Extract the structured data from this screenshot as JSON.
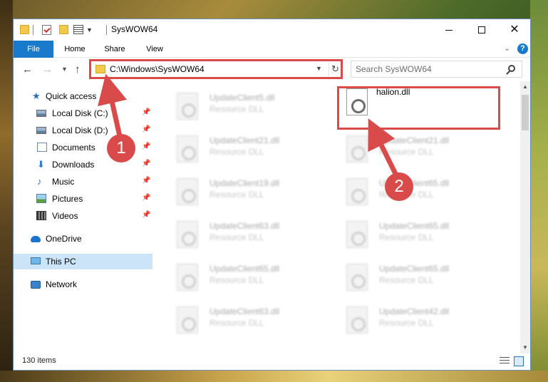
{
  "window": {
    "title": "SysWOW64",
    "controls": {
      "minimize": "minimize",
      "maximize": "maximize",
      "close": "close"
    }
  },
  "ribbon": {
    "tabs": [
      "File",
      "Home",
      "Share",
      "View"
    ],
    "help": "?"
  },
  "address": {
    "path": "C:\\Windows\\SysWOW64",
    "search_placeholder": "Search SysWOW64"
  },
  "nav": {
    "quick_access": "Quick access",
    "items": [
      {
        "label": "Local Disk (C:)",
        "icon": "drive-icon",
        "pinned": true
      },
      {
        "label": "Local Disk (D:)",
        "icon": "drive-icon",
        "pinned": true
      },
      {
        "label": "Documents",
        "icon": "documents-icon",
        "pinned": true
      },
      {
        "label": "Downloads",
        "icon": "downloads-icon",
        "pinned": true
      },
      {
        "label": "Music",
        "icon": "music-icon",
        "pinned": true
      },
      {
        "label": "Pictures",
        "icon": "pictures-icon",
        "pinned": true
      },
      {
        "label": "Videos",
        "icon": "videos-icon",
        "pinned": true
      }
    ],
    "onedrive": "OneDrive",
    "this_pc": "This PC",
    "network": "Network"
  },
  "files": [
    {
      "name": "UpdateClient5.dll",
      "type": "Resource DLL"
    },
    {
      "name": "halion.dll",
      "type": ""
    },
    {
      "name": "UpdateClient21.dll",
      "type": "Resource DLL"
    },
    {
      "name": "UpdateClient21.dll",
      "type": "Resource DLL"
    },
    {
      "name": "UpdateClient19.dll",
      "type": "Resource DLL"
    },
    {
      "name": "UpdateClient65.dll",
      "type": "Resource DLL"
    },
    {
      "name": "UpdateClient63.dll",
      "type": "Resource DLL"
    },
    {
      "name": "UpdateClient65.dll",
      "type": "Resource DLL"
    },
    {
      "name": "UpdateClient65.dll",
      "type": "Resource DLL"
    },
    {
      "name": "UpdateClient65.dll",
      "type": "Resource DLL"
    },
    {
      "name": "UpdateClient63.dll",
      "type": "Resource DLL"
    },
    {
      "name": "UpdateClient42.dll",
      "type": "Resource DLL"
    }
  ],
  "status": {
    "item_count": "130 items"
  },
  "callouts": [
    "1",
    "2"
  ],
  "colors": {
    "accent": "#1979ca",
    "highlight": "#d94b4b",
    "selected_nav": "#cce4f7"
  }
}
